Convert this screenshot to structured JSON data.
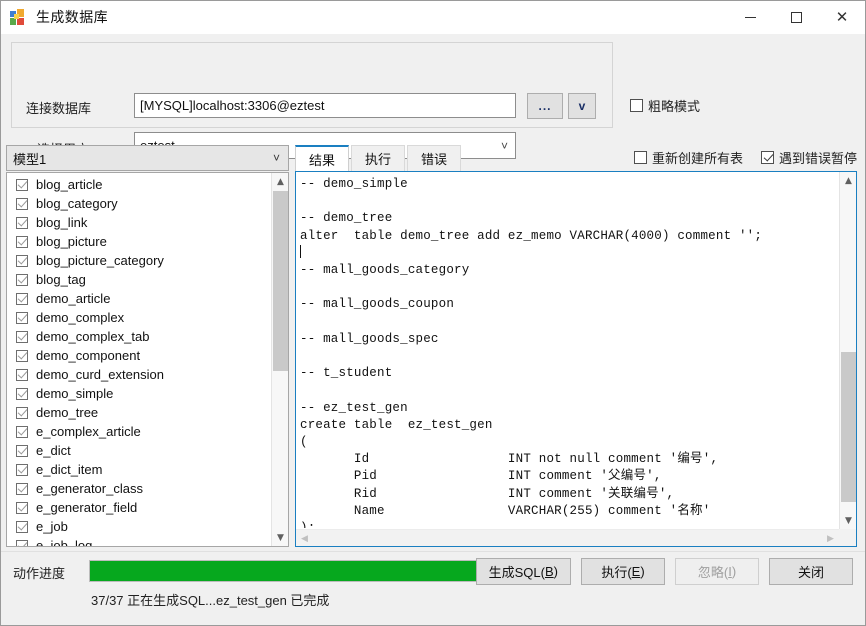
{
  "window": {
    "title": "生成数据库",
    "icon": "database-blocks-icon",
    "minimize": "—",
    "maximize": "□",
    "close": "✕"
  },
  "connection": {
    "db_label": "连接数据库",
    "db_value": "[MYSQL]localhost:3306@eztest",
    "user_label": "选择用户",
    "user_value": "eztest",
    "browse_button": "...",
    "dropdown_button": "v",
    "rough_mode_label": "粗略模式",
    "rough_mode_checked": false
  },
  "left_panel": {
    "model_selected": "模型1",
    "tables": [
      {
        "name": "blog_article",
        "checked": true
      },
      {
        "name": "blog_category",
        "checked": true
      },
      {
        "name": "blog_link",
        "checked": true
      },
      {
        "name": "blog_picture",
        "checked": true
      },
      {
        "name": "blog_picture_category",
        "checked": true
      },
      {
        "name": "blog_tag",
        "checked": true
      },
      {
        "name": "demo_article",
        "checked": true
      },
      {
        "name": "demo_complex",
        "checked": true
      },
      {
        "name": "demo_complex_tab",
        "checked": true
      },
      {
        "name": "demo_component",
        "checked": true
      },
      {
        "name": "demo_curd_extension",
        "checked": true
      },
      {
        "name": "demo_simple",
        "checked": true
      },
      {
        "name": "demo_tree",
        "checked": true
      },
      {
        "name": "e_complex_article",
        "checked": true
      },
      {
        "name": "e_dict",
        "checked": true
      },
      {
        "name": "e_dict_item",
        "checked": true
      },
      {
        "name": "e_generator_class",
        "checked": true
      },
      {
        "name": "e_generator_field",
        "checked": true
      },
      {
        "name": "e_job",
        "checked": true
      },
      {
        "name": "e_job_log",
        "checked": true
      }
    ]
  },
  "right_panel": {
    "tabs": [
      {
        "label": "结果",
        "active": true
      },
      {
        "label": "执行",
        "active": false
      },
      {
        "label": "错误",
        "active": false
      }
    ],
    "recreate_all_label": "重新创建所有表",
    "recreate_all_checked": false,
    "pause_on_error_label": "遇到错误暂停",
    "pause_on_error_checked": true,
    "sql_text": "-- demo_simple\n\n-- demo_tree\nalter  table demo_tree add ez_memo VARCHAR(4000) comment '';\n\n-- mall_goods_category\n\n-- mall_goods_coupon\n\n-- mall_goods_spec\n\n-- t_student\n\n-- ez_test_gen\ncreate table  ez_test_gen\n(\n       Id                  INT not null comment '编号',\n       Pid                 INT comment '父编号',\n       Rid                 INT comment '关联编号',\n       Name                VARCHAR(255) comment '名称'\n);\nalter  table ez_test_gen\n       add constraint PK_ez_test_gen_Id primary key (Id);"
  },
  "bottom": {
    "progress_label": "动作进度",
    "progress_percent": 100,
    "status_text": "37/37 正在生成SQL...ez_test_gen 已完成",
    "buttons": [
      {
        "label": "生成SQL(B)",
        "accel": "B",
        "disabled": false
      },
      {
        "label": "执行(E)",
        "accel": "E",
        "disabled": false
      },
      {
        "label": "忽略(I)",
        "accel": "I",
        "disabled": true
      },
      {
        "label": "关闭",
        "accel": "",
        "disabled": false
      }
    ]
  },
  "colors": {
    "accent": "#1a7fc1",
    "progress_green": "#06a81e",
    "button_glyph": "#1a2f66"
  }
}
